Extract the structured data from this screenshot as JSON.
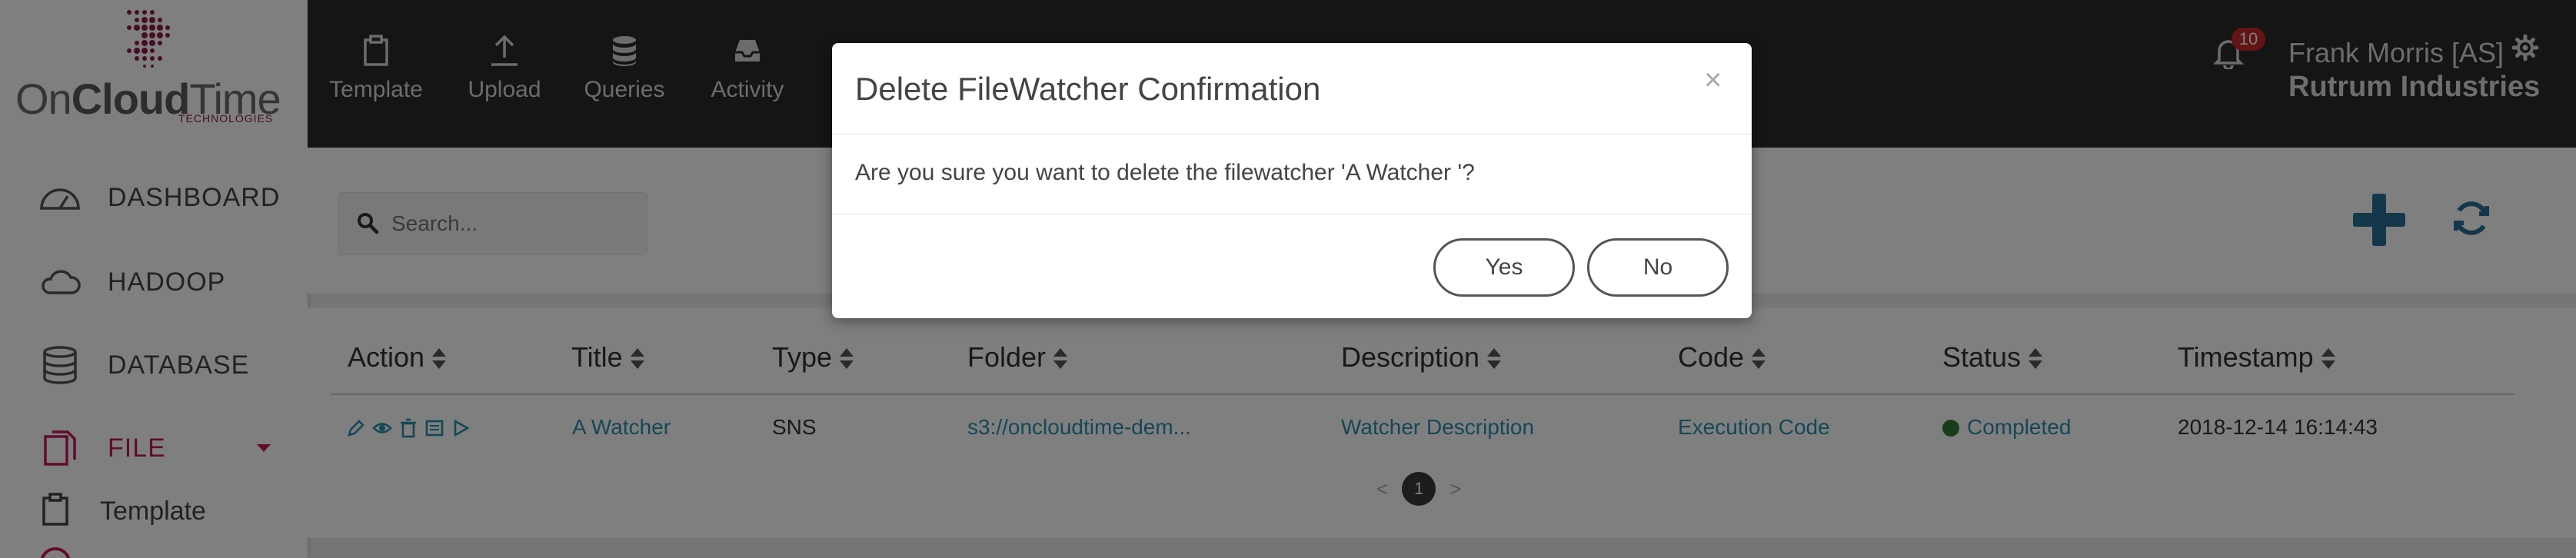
{
  "logo": {
    "word_light": "On",
    "word_bold": "Cloud",
    "word_rest": "Time",
    "tagline": "TECHNOLOGIES"
  },
  "sidebar": {
    "items": [
      {
        "label": "DASHBOARD",
        "icon": "dashboard-icon"
      },
      {
        "label": "HADOOP",
        "icon": "cloud-icon"
      },
      {
        "label": "DATABASE",
        "icon": "database-icon"
      },
      {
        "label": "FILE",
        "icon": "file-icon"
      }
    ],
    "sub_items": [
      {
        "label": "Template",
        "icon": "clipboard-icon"
      }
    ]
  },
  "topbar": {
    "items": [
      {
        "label": "Template",
        "icon": "clipboard-icon"
      },
      {
        "label": "Upload",
        "icon": "upload-icon"
      },
      {
        "label": "Queries",
        "icon": "database-icon"
      },
      {
        "label": "Activity",
        "icon": "inbox-icon"
      }
    ],
    "notifications": "10",
    "user": "Frank Morris [AS]",
    "company": "Rutrum Industries"
  },
  "search": {
    "placeholder": "Search..."
  },
  "table": {
    "headers": [
      "Action",
      "Title",
      "Type",
      "Folder",
      "Description",
      "Code",
      "Status",
      "Timestamp"
    ],
    "row": {
      "title": "A Watcher",
      "type": "SNS",
      "folder": "s3://oncloudtime-dem...",
      "description": "Watcher Description",
      "code": "Execution Code",
      "status": "Completed",
      "timestamp": "2018-12-14 16:14:43"
    },
    "pager": {
      "prev": "<",
      "page": "1",
      "next": ">"
    }
  },
  "modal": {
    "title": "Delete FileWatcher Confirmation",
    "close": "×",
    "message": "Are you sure you want to delete the filewatcher 'A Watcher '?",
    "yes": "Yes",
    "no": "No"
  },
  "colors": {
    "accent": "#c2185b",
    "link": "#2a8fb0",
    "topbar": "#2b2b2b",
    "status_ok": "#2e7d32"
  }
}
